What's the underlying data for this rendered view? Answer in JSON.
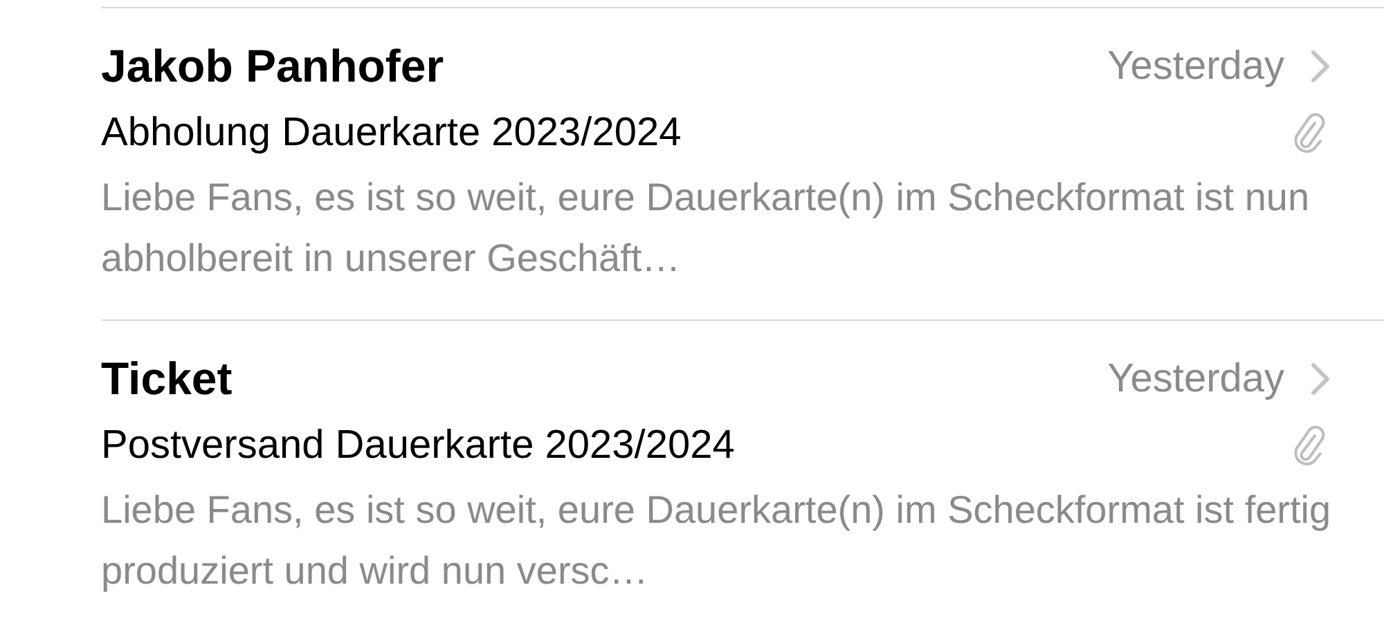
{
  "messages": [
    {
      "sender": "Jakob Panhofer",
      "date": "Yesterday",
      "subject": "Abholung Dauerkarte 2023/2024",
      "preview": "Liebe Fans, es ist so weit, eure Dauerkarte(n) im Scheckformat ist nun abholbereit in unserer Geschäft…",
      "has_attachment": true
    },
    {
      "sender": "Ticket",
      "date": "Yesterday",
      "subject": "Postversand Dauerkarte 2023/2024",
      "preview": "Liebe Fans, es ist so weit, eure Dauerkarte(n) im Scheckformat ist fertig produziert und wird nun versc…",
      "has_attachment": true
    }
  ]
}
